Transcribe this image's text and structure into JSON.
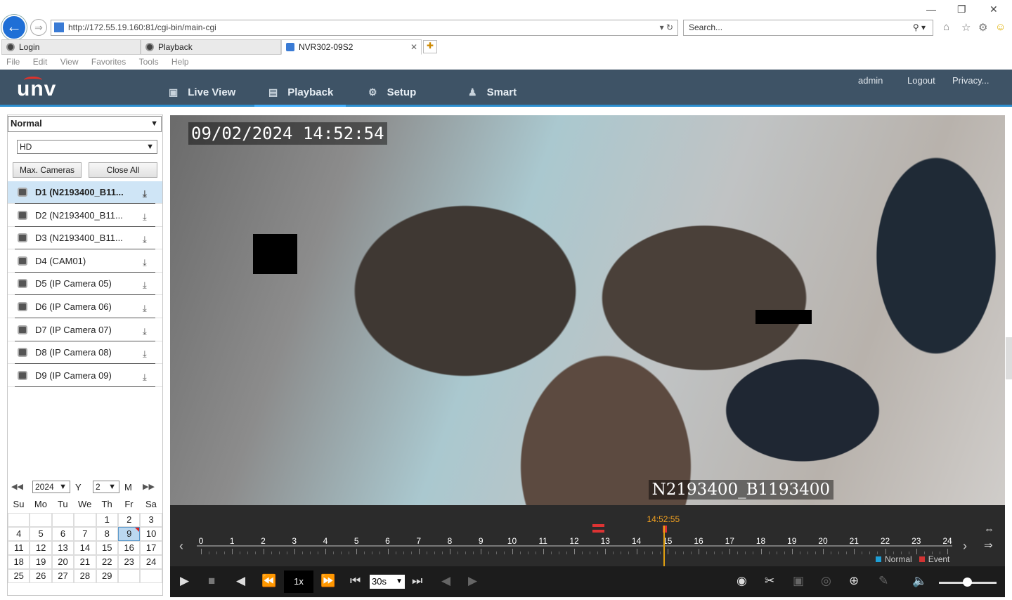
{
  "browser": {
    "url": "http://172.55.19.160:81/cgi-bin/main-cgi",
    "search_placeholder": "Search...",
    "tabs": [
      {
        "label": "Login"
      },
      {
        "label": "Playback"
      },
      {
        "label": "NVR302-09S2"
      }
    ],
    "menu": [
      "File",
      "Edit",
      "View",
      "Favorites",
      "Tools",
      "Help"
    ]
  },
  "app": {
    "logo": "unv",
    "nav": [
      {
        "label": "Live View",
        "icon": "monitor-icon"
      },
      {
        "label": "Playback",
        "icon": "playback-icon"
      },
      {
        "label": "Setup",
        "icon": "gear-icon"
      },
      {
        "label": "Smart",
        "icon": "smart-icon"
      }
    ],
    "active_nav": "Playback",
    "header_links": {
      "user": "admin",
      "logout": "Logout",
      "privacy": "Privacy..."
    }
  },
  "left_panel": {
    "record_type": "Normal",
    "stream": "HD",
    "max_cameras_label": "Max. Cameras",
    "close_all_label": "Close All",
    "cameras": [
      "D1 (N2193400_B11...",
      "D2 (N2193400_B11...",
      "D3 (N2193400_B11...",
      "D4 (CAM01)",
      "D5 (IP Camera 05)",
      "D6 (IP Camera 06)",
      "D7 (IP Camera 07)",
      "D8 (IP Camera 08)",
      "D9 (IP Camera 09)"
    ],
    "selected_camera_index": 0
  },
  "calendar": {
    "year": "2024",
    "year_label": "Y",
    "month": "2",
    "month_label": "M",
    "dow": [
      "Su",
      "Mo",
      "Tu",
      "We",
      "Th",
      "Fr",
      "Sa"
    ],
    "weeks": [
      [
        "",
        "",
        "",
        "",
        "1",
        "2",
        "3"
      ],
      [
        "4",
        "5",
        "6",
        "7",
        "8",
        "9",
        "10"
      ],
      [
        "11",
        "12",
        "13",
        "14",
        "15",
        "16",
        "17"
      ],
      [
        "18",
        "19",
        "20",
        "21",
        "22",
        "23",
        "24"
      ],
      [
        "25",
        "26",
        "27",
        "28",
        "29",
        "",
        ""
      ]
    ],
    "selected_day": "9",
    "days_with_record": [
      "9"
    ]
  },
  "video": {
    "timestamp": "09/02/2024 14:52:54",
    "camera_name": "N2193400_B1193400"
  },
  "timeline": {
    "hours": [
      "0",
      "1",
      "2",
      "3",
      "4",
      "5",
      "6",
      "7",
      "8",
      "9",
      "10",
      "11",
      "12",
      "13",
      "14",
      "15",
      "16",
      "17",
      "18",
      "19",
      "20",
      "21",
      "22",
      "23",
      "24"
    ],
    "cursor_time": "14:52:55",
    "cursor_hour": 14.88,
    "legend": {
      "normal": "Normal",
      "event": "Event"
    },
    "colors": {
      "normal": "#1e9fd6",
      "event": "#d33333",
      "cursor": "#e0a010"
    }
  },
  "controls": {
    "speed": "1x",
    "interval": "30s"
  }
}
